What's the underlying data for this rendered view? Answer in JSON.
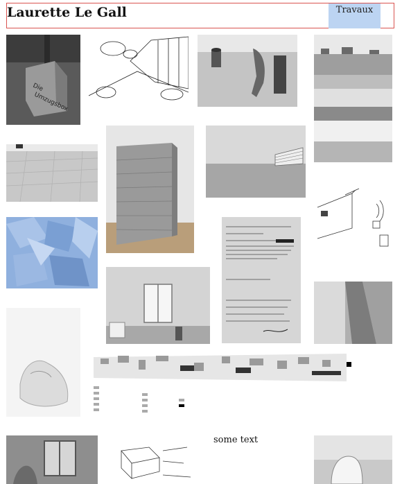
{
  "header": {
    "title": "Laurette Le Gall",
    "nav_button": "Travaux"
  },
  "gallery": {
    "caption": "some text"
  },
  "colors": {
    "header_border": "#d9534f",
    "nav_button_bg": "#bcd4f2",
    "tinted_image": "#8fb0de"
  }
}
